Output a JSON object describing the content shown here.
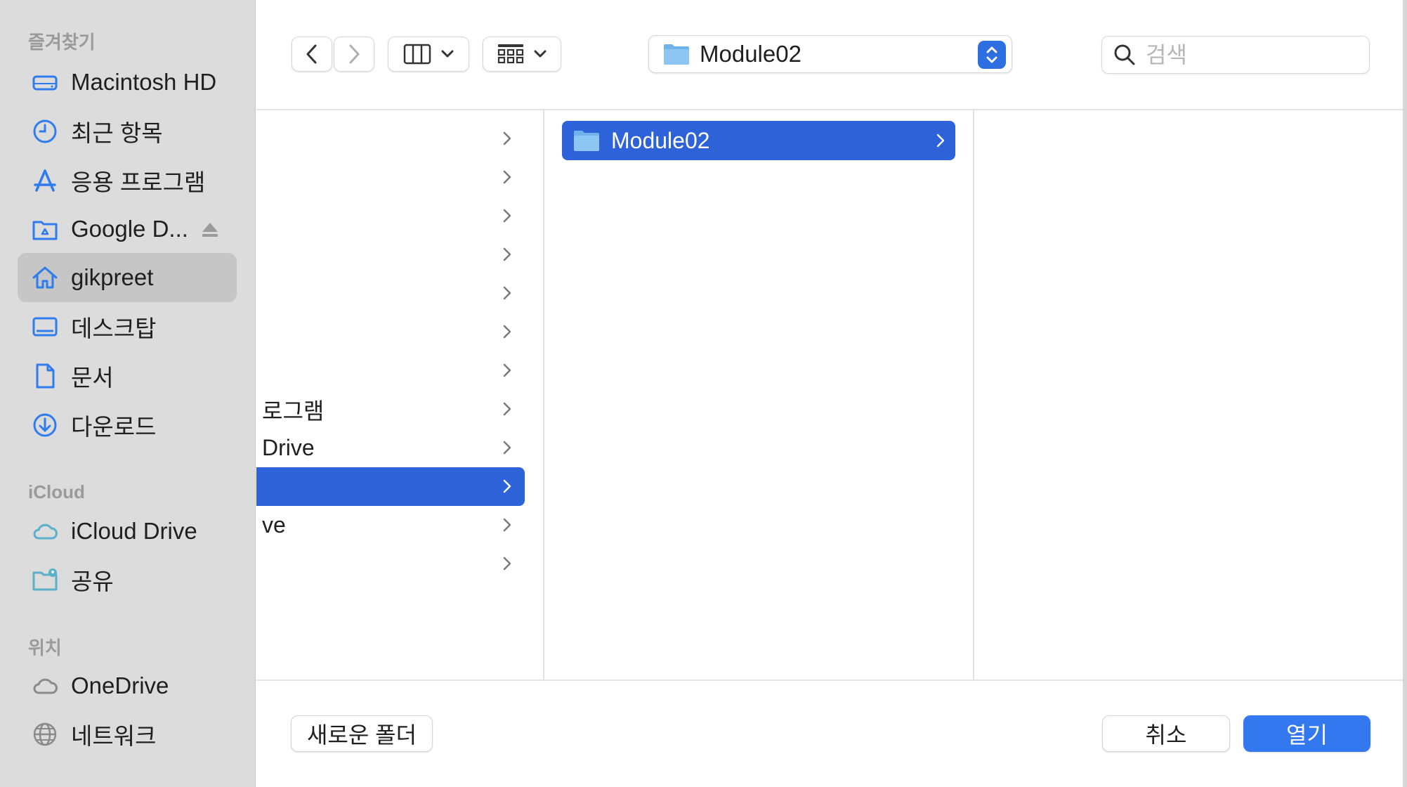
{
  "sidebar": {
    "favorites_header": "즐겨찾기",
    "icloud_header": "iCloud",
    "locations_header": "위치",
    "favorites": [
      {
        "label": "Macintosh HD",
        "icon": "drive-icon"
      },
      {
        "label": "최근 항목",
        "icon": "clock-icon"
      },
      {
        "label": "응용 프로그램",
        "icon": "applications-icon"
      },
      {
        "label": "Google D...",
        "icon": "google-drive-folder-icon"
      },
      {
        "label": "gikpreet",
        "icon": "home-icon"
      },
      {
        "label": "데스크탑",
        "icon": "desktop-icon"
      },
      {
        "label": "문서",
        "icon": "document-icon"
      },
      {
        "label": "다운로드",
        "icon": "download-icon"
      }
    ],
    "icloud": [
      {
        "label": "iCloud Drive",
        "icon": "cloud-icon"
      },
      {
        "label": "공유",
        "icon": "shared-folder-icon"
      }
    ],
    "locations": [
      {
        "label": "OneDrive",
        "icon": "cloud-icon"
      },
      {
        "label": "네트워크",
        "icon": "globe-icon"
      }
    ],
    "selected": "gikpreet"
  },
  "toolbar": {
    "path_folder": "Module02",
    "search_placeholder": "검색"
  },
  "columns": {
    "col1": [
      "",
      "",
      "",
      "",
      "",
      "",
      "",
      "로그램",
      " Drive",
      "",
      "ve",
      ""
    ],
    "col1_selected_index": 9,
    "col2": [
      {
        "label": "Module02",
        "selected": true
      }
    ]
  },
  "buttons": {
    "new_folder": "새로운 폴더",
    "cancel": "취소",
    "open": "열기"
  },
  "colors": {
    "accent": "#3478f0",
    "selection": "#2d62d8",
    "sidebar_bg": "#dcdcdc",
    "icon_blue": "#2f7bf0"
  }
}
